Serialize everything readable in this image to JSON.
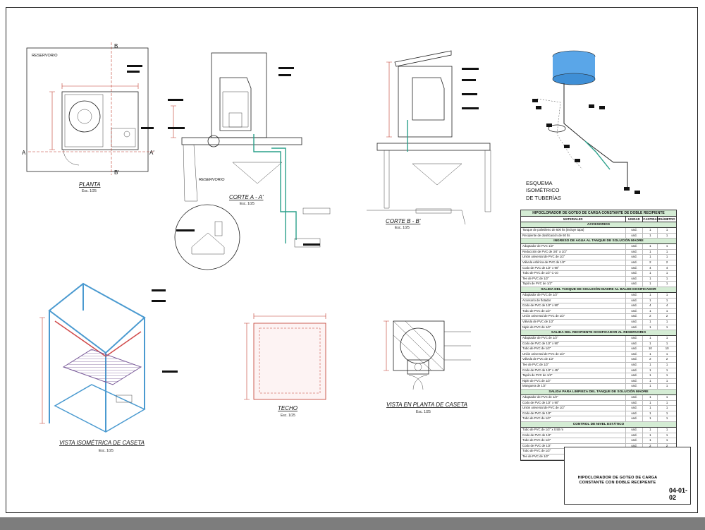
{
  "views": {
    "planta": {
      "title": "PLANTA",
      "scale": "Esc. 1/25",
      "note": "RESERVORIO",
      "cut_b_top": "B",
      "cut_b_bottom": "B'",
      "cut_a_left": "A",
      "cut_a_right": "A'"
    },
    "corte_a": {
      "title": "CORTE A - A'",
      "scale": "Esc. 1/25",
      "note": "RESERVORIO"
    },
    "corte_b": {
      "title": "CORTE B - B'",
      "scale": "Esc. 1/25"
    },
    "esquema": {
      "title_line1": "ESQUEMA",
      "title_line2": "ISOMÉTRICO",
      "title_line3": "DE TUBERÍAS"
    },
    "isometrica": {
      "title": "VISTA ISOMÉTRICA DE CASETA",
      "scale": "Esc. 1/25"
    },
    "techo": {
      "title": "TECHO",
      "scale": "Esc. 1/25"
    },
    "planta_caseta": {
      "title": "VISTA EN PLANTA DE CASETA",
      "scale": "Esc. 1/25"
    }
  },
  "materials_table": {
    "title": "HIPOCLORADOR DE GOTEO DE CARGA CONSTANTE DE DOBLE RECIPIENTE",
    "headers": [
      "MATERIALES",
      "UNIDAD",
      "CANTIDAD",
      "DIÁMETRO"
    ],
    "sections": [
      {
        "name": "ACCESORIOS",
        "rows": [
          [
            "Tanque de polietileno de 600 lts (incluye tapa)",
            "und.",
            "1",
            "1"
          ],
          [
            "Recipiente de dosificación de 60 lts",
            "und.",
            "1",
            "1"
          ]
        ]
      },
      {
        "name": "INGRESO DE AGUA AL TANQUE DE SOLUCIÓN MADRE",
        "rows": [
          [
            "Adaptador de PVC 1/2\"",
            "und.",
            "1",
            "1"
          ],
          [
            "Reducción de PVC de 3/4\" a 1/2\"",
            "und.",
            "1",
            "1"
          ],
          [
            "Unión universal de PVC de 1/2\"",
            "und.",
            "1",
            "1"
          ],
          [
            "Válvula esférica de PVC de 1/2\"",
            "und.",
            "2",
            "2"
          ],
          [
            "Codo de PVC de 1/2\" x 90°",
            "und.",
            "4",
            "4"
          ],
          [
            "Tubo de PVC de 1/2\" C-10",
            "und.",
            "1",
            "1"
          ],
          [
            "Tee de PVC de 1/2\"",
            "und.",
            "1",
            "1"
          ],
          [
            "Tapón de PVC de 1/2\"",
            "und.",
            "1",
            "1"
          ]
        ]
      },
      {
        "name": "SALIDA DEL TANQUE DE SOLUCIÓN MADRE AL BALDE DOSIFICADOR",
        "rows": [
          [
            "Adaptador de PVC de 1/2\"",
            "und.",
            "1",
            "1"
          ],
          [
            "Accesorio de flotador",
            "und.",
            "1",
            "1"
          ],
          [
            "Codo de PVC de 1/2\" x 90°",
            "und.",
            "4",
            "4"
          ],
          [
            "Tubo de PVC de 1/2\"",
            "und.",
            "1",
            "1"
          ],
          [
            "Unión universal de PVC de 1/2\"",
            "und.",
            "2",
            "2"
          ],
          [
            "Válvula de PVC de 1/2\"",
            "und.",
            "1",
            "1"
          ],
          [
            "Niple de PVC de 1/2\"",
            "und.",
            "1",
            "1"
          ]
        ]
      },
      {
        "name": "SALIDA DEL RECIPIENTE DOSIFICADOR AL RESERVORIO",
        "rows": [
          [
            "Adaptador de PVC de 1/2\"",
            "und.",
            "1",
            "1"
          ],
          [
            "Codo de PVC de 1/2\" x 90°",
            "und.",
            "1",
            "1"
          ],
          [
            "Tubo de PVC de 1/2\"",
            "und.",
            "10",
            "10"
          ],
          [
            "Unión universal de PVC de 1/2\"",
            "und.",
            "1",
            "1"
          ],
          [
            "Válvula de PVC de 1/2\"",
            "und.",
            "2",
            "2"
          ],
          [
            "Tee de PVC de 1/2\"",
            "und.",
            "1",
            "1"
          ],
          [
            "Codo de PVC de 1/2\" x 45°",
            "und.",
            "1",
            "1"
          ],
          [
            "Tapón de PVC de 1/2\"",
            "und.",
            "1",
            "1"
          ],
          [
            "Niple de PVC de 1/2\"",
            "und.",
            "1",
            "1"
          ],
          [
            "Manguera de 1/2\"",
            "und.",
            "1",
            "1"
          ]
        ]
      },
      {
        "name": "SALIDA PARA LIMPIEZA DEL TANQUE DE SOLUCIÓN MADRE",
        "rows": [
          [
            "Adaptador de PVC de 1/2\"",
            "und.",
            "1",
            "1"
          ],
          [
            "Codo de PVC de 1/2\" x 90°",
            "und.",
            "1",
            "1"
          ],
          [
            "Unión universal de PVC de 1/2\"",
            "und.",
            "1",
            "1"
          ],
          [
            "Codo de PVC de 1/2\"",
            "und.",
            "1",
            "1"
          ],
          [
            "Tubo de PVC de 1/2\"",
            "und.",
            "1",
            "1"
          ]
        ]
      },
      {
        "name": "CONTROL DE NIVEL ESTÁTICO",
        "rows": [
          [
            "Tubo de PVC de 1/2\" x 0.50 m",
            "und.",
            "1",
            "1"
          ],
          [
            "Codo de PVC de 1/2\"",
            "und.",
            "1",
            "1"
          ],
          [
            "Tubo de PVC de 1/2\"",
            "und.",
            "1",
            "1"
          ],
          [
            "Codo de PVC de 1/2\"",
            "und.",
            "2",
            "2"
          ],
          [
            "Tubo de PVC de 1/2\"",
            "und.",
            "2",
            "2"
          ],
          [
            "Tee de PVC de 1/2\"",
            "und.",
            "1",
            "1"
          ]
        ]
      }
    ]
  },
  "title_block": {
    "project_line1": "HIPOCLORADOR DE GOTEO DE CARGA",
    "project_line2": "CONSTANTE CON DOBLE RECIPIENTE",
    "sheet_code": "04-01-02"
  },
  "colors": {
    "dimension": "#c0392b",
    "pipe": "#2aa08a",
    "table_header": "#d4ecd4",
    "tank_water": "#5aa6e8"
  }
}
